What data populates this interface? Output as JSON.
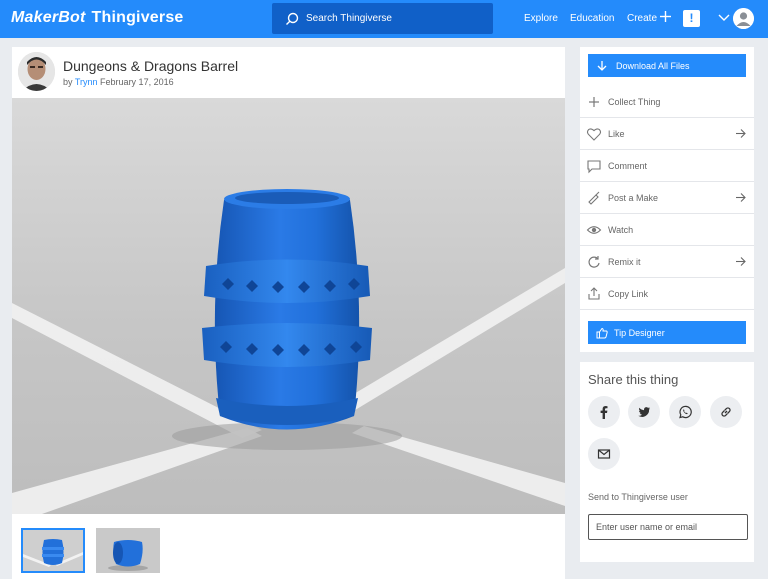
{
  "header": {
    "logo_brand": "MakerBot",
    "logo_product": "Thingiverse",
    "search_placeholder": "Search Thingiverse",
    "nav": {
      "explore": "Explore",
      "education": "Education",
      "create": "Create"
    },
    "notification_badge": "!"
  },
  "thing": {
    "title": "Dungeons & Dragons Barrel",
    "by_prefix": "by",
    "author": "Trynn",
    "date": "February 17, 2016"
  },
  "actions": {
    "download_label": "Download All Files",
    "items": [
      {
        "label": "Collect Thing",
        "icon": "plus-icon",
        "has_arrow": false
      },
      {
        "label": "Like",
        "icon": "heart-icon",
        "has_arrow": true
      },
      {
        "label": "Comment",
        "icon": "comment-icon",
        "has_arrow": false
      },
      {
        "label": "Post a Make",
        "icon": "make-icon",
        "has_arrow": true
      },
      {
        "label": "Watch",
        "icon": "eye-icon",
        "has_arrow": false
      },
      {
        "label": "Remix it",
        "icon": "remix-icon",
        "has_arrow": true
      },
      {
        "label": "Copy Link",
        "icon": "link-icon",
        "has_arrow": false
      }
    ],
    "tip_label": "Tip Designer"
  },
  "share": {
    "title": "Share this thing",
    "buttons": [
      "facebook-icon",
      "twitter-icon",
      "whatsapp-icon",
      "link-icon",
      "email-icon"
    ],
    "send_label": "Send to Thingiverse user",
    "input_placeholder": "Enter user name or email"
  },
  "colors": {
    "brand_blue": "#248bfb",
    "barrel_blue": "#1f6fd8",
    "page_bg": "#e9ecf0"
  }
}
